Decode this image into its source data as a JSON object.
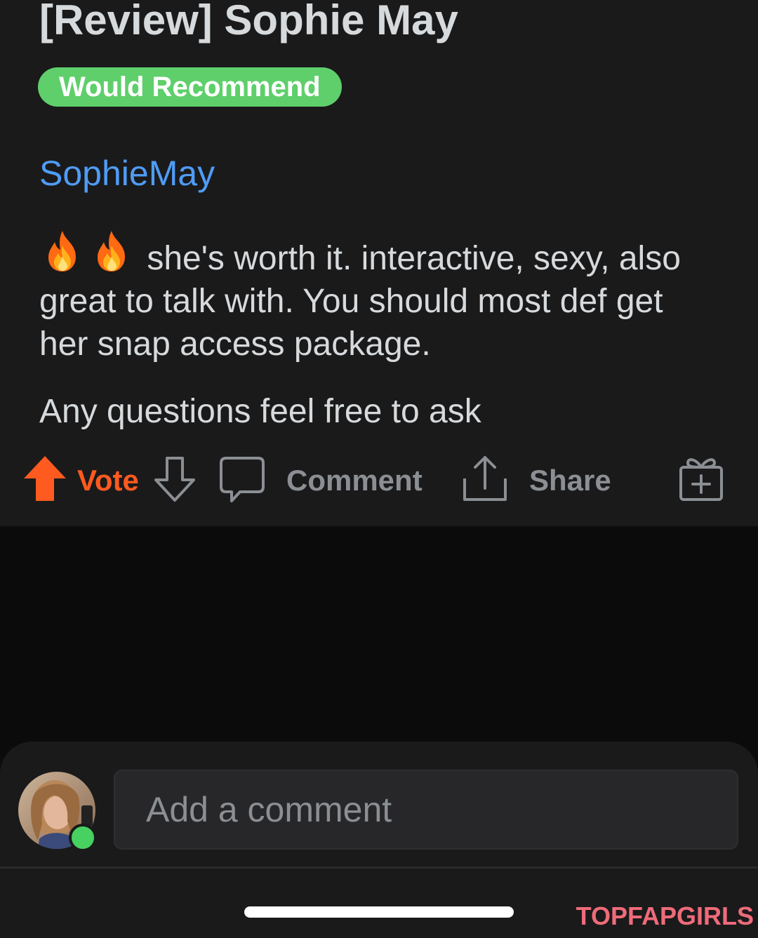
{
  "post": {
    "title": "[Review] Sophie May",
    "flair": "Would Recommend",
    "link": "SophieMay",
    "body_text": "she's worth it. interactive, sexy, also great to talk with. You should most def get her snap access package.",
    "body_text_2": "Any questions feel free to ask"
  },
  "actions": {
    "vote_label": "Vote",
    "comment_label": "Comment",
    "share_label": "Share"
  },
  "composer": {
    "placeholder": "Add a comment"
  },
  "watermark": "TOPFAPGIRLS",
  "colors": {
    "background": "#0b0b0b",
    "card": "#1a1a1b",
    "text": "#d7dadc",
    "flair": "#5fcf6b",
    "link": "#4f9cf5",
    "upvote": "#ff5a1f",
    "muted": "#8b8f93",
    "online": "#46d160"
  },
  "icons": [
    "flame-icon",
    "upvote-arrow-icon",
    "downvote-arrow-icon",
    "comment-bubble-icon",
    "share-icon",
    "gift-icon"
  ]
}
